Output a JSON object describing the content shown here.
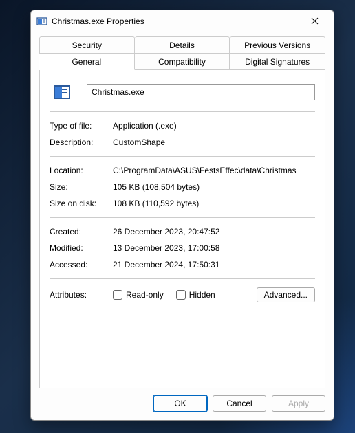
{
  "window": {
    "title": "Christmas.exe Properties"
  },
  "tabs": {
    "row1": [
      "Security",
      "Details",
      "Previous Versions"
    ],
    "row2": [
      "General",
      "Compatibility",
      "Digital Signatures"
    ],
    "active": "General"
  },
  "general": {
    "filename": "Christmas.exe",
    "type_of_file_label": "Type of file:",
    "type_of_file": "Application (.exe)",
    "description_label": "Description:",
    "description": "CustomShape",
    "location_label": "Location:",
    "location": "C:\\ProgramData\\ASUS\\FestsEffec\\data\\Christmas",
    "size_label": "Size:",
    "size": "105 KB (108,504 bytes)",
    "size_on_disk_label": "Size on disk:",
    "size_on_disk": "108 KB (110,592 bytes)",
    "created_label": "Created:",
    "created": "26 December 2023, 20:47:52",
    "modified_label": "Modified:",
    "modified": "13 December 2023, 17:00:58",
    "accessed_label": "Accessed:",
    "accessed": "21 December 2024, 17:50:31",
    "attributes_label": "Attributes:",
    "read_only_label": "Read-only",
    "hidden_label": "Hidden",
    "advanced_label": "Advanced..."
  },
  "buttons": {
    "ok": "OK",
    "cancel": "Cancel",
    "apply": "Apply"
  }
}
